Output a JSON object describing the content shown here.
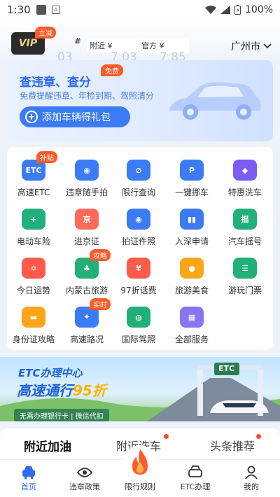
{
  "status": {
    "time": "1:30",
    "battery": "100%"
  },
  "header": {
    "vip_label": "VIP",
    "vip_badge": "立减",
    "hash": "#",
    "filter_nearby": "附近 ¥",
    "filter_official": "官方 ¥",
    "ghost_left": "03",
    "ghost_mid": "7.03",
    "ghost_right": "7.85",
    "city": "广州市"
  },
  "promo": {
    "title": "查违章、查分",
    "badge": "免费",
    "subtitle": "免费提醒违章、年检到期、驾照清分",
    "button": "添加车辆得礼包"
  },
  "services": [
    {
      "label": "高速ETC",
      "tag": "补贴",
      "icon": "etc-icon",
      "color": "#3b7bf6",
      "glyph": "ETC"
    },
    {
      "label": "违章随手拍",
      "tag": "",
      "icon": "camera-icon",
      "color": "#3b7bf6",
      "glyph": "◉"
    },
    {
      "label": "限行查询",
      "tag": "",
      "icon": "no-entry-icon",
      "color": "#3b7bf6",
      "glyph": "⊘"
    },
    {
      "label": "一键挪车",
      "tag": "",
      "icon": "parking-icon",
      "color": "#3b7bf6",
      "glyph": "P"
    },
    {
      "label": "特惠洗车",
      "tag": "",
      "icon": "car-wash-icon",
      "color": "#7b5cf5",
      "glyph": "◆"
    },
    {
      "label": "电动车险",
      "tag": "",
      "icon": "shield-plus-icon",
      "color": "#21b07a",
      "glyph": "+"
    },
    {
      "label": "进京证",
      "tag": "",
      "icon": "beijing-permit-icon",
      "color": "#ff6b5a",
      "glyph": "京"
    },
    {
      "label": "拍证件照",
      "tag": "",
      "icon": "id-photo-camera-icon",
      "color": "#3b7bf6",
      "glyph": "◉"
    },
    {
      "label": "入深申请",
      "tag": "",
      "icon": "city-building-icon",
      "color": "#3b7bf6",
      "glyph": "▮▮"
    },
    {
      "label": "汽车摇号",
      "tag": "",
      "icon": "lottery-icon",
      "color": "#21b07a",
      "glyph": "摇"
    },
    {
      "label": "今日运势",
      "tag": "",
      "icon": "star-fortune-icon",
      "color": "#ff5a4a",
      "glyph": "✡"
    },
    {
      "label": "内蒙古旅游",
      "tag": "攻略",
      "icon": "palm-tree-icon",
      "color": "#21b07a",
      "glyph": "♣"
    },
    {
      "label": "97折话费",
      "tag": "",
      "icon": "phone-bill-icon",
      "color": "#ff5a4a",
      "glyph": "¥"
    },
    {
      "label": "旅游美食",
      "tag": "",
      "icon": "roast-chicken-icon",
      "color": "#ffa51a",
      "glyph": "●"
    },
    {
      "label": "游玩门票",
      "tag": "",
      "icon": "ticket-icon",
      "color": "#21b07a",
      "glyph": "☰"
    },
    {
      "label": "身份证攻略",
      "tag": "",
      "icon": "id-card-icon",
      "color": "#ffa51a",
      "glyph": "▬"
    },
    {
      "label": "高速路况",
      "tag": "实时",
      "icon": "map-pin-icon",
      "color": "#3b7bf6",
      "glyph": "⌖"
    },
    {
      "label": "国际驾照",
      "tag": "",
      "icon": "globe-icon",
      "color": "#21b07a",
      "glyph": "◍"
    },
    {
      "label": "全部服务",
      "tag": "",
      "icon": "all-services-grid-icon",
      "color": "#8a74f0",
      "glyph": "▦"
    }
  ],
  "banner": {
    "line1": "ETC办理中心",
    "line2_prefix": "高速通行",
    "line2_highlight": "95折",
    "note": "无需办理银行卡 | 微信代扣",
    "sign": "ETC"
  },
  "tabs": [
    "附近加油",
    "附近洗车",
    "头条推荐"
  ],
  "nav": [
    {
      "label": "首页",
      "icon": "home-car-icon",
      "active": true
    },
    {
      "label": "违章政策",
      "icon": "eye-icon",
      "active": false
    },
    {
      "label": "限行规则",
      "icon": "fire-icon",
      "active": false
    },
    {
      "label": "ETC办理",
      "icon": "etc-car-icon",
      "active": false
    },
    {
      "label": "我的",
      "icon": "user-icon",
      "active": false
    }
  ]
}
